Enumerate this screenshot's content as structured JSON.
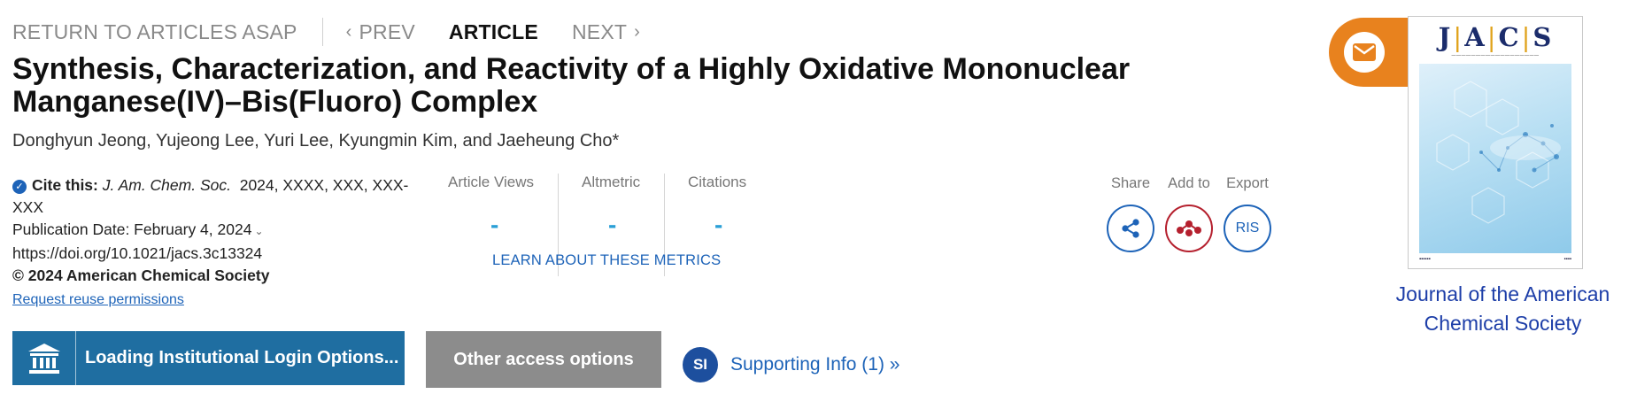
{
  "nav": {
    "return_label": "RETURN TO ARTICLES ASAP",
    "prev_label": "PREV",
    "article_label": "ARTICLE",
    "next_label": "NEXT"
  },
  "article": {
    "title": "Synthesis, Characterization, and Reactivity of a Highly Oxidative Mononuclear Manganese(IV)–Bis(Fluoro) Complex",
    "authors": "Donghyun Jeong, Yujeong Lee, Yuri Lee, Kyungmin Kim, and Jaeheung Cho*"
  },
  "cite": {
    "label": "Cite this:",
    "journal": "J. Am. Chem. Soc.",
    "details": "2024, XXXX, XXX, XXX-XXX",
    "pub_date": "Publication Date: February 4, 2024",
    "doi": "https://doi.org/10.1021/jacs.3c13324",
    "copyright": "© 2024 American Chemical Society",
    "reuse": "Request reuse permissions"
  },
  "metrics": {
    "views_label": "Article Views",
    "views_value": "-",
    "altmetric_label": "Altmetric",
    "altmetric_value": "-",
    "citations_label": "Citations",
    "citations_value": "-",
    "learn_label": "LEARN ABOUT THESE METRICS"
  },
  "tools": {
    "share_label": "Share",
    "add_label": "Add to",
    "export_label": "Export",
    "export_icon_text": "RIS"
  },
  "buttons": {
    "institutional": "Loading Institutional Login Options...",
    "other_access": "Other access options",
    "supporting_badge": "SI",
    "supporting_label": "Supporting Info (1) »"
  },
  "cover": {
    "journal_name": "Journal of the American Chemical Society",
    "cover_letters": [
      "J",
      "A",
      "C",
      "S"
    ]
  },
  "colors": {
    "accent_blue": "#1d63b8",
    "button_blue": "#1f6ea1",
    "button_gray": "#8c8c8c",
    "email_orange": "#e8821e",
    "add_red": "#b5202e"
  },
  "icons": {
    "email": "envelope-icon",
    "share": "share-icon",
    "add": "mendeley-icon",
    "institution": "bank-icon"
  }
}
